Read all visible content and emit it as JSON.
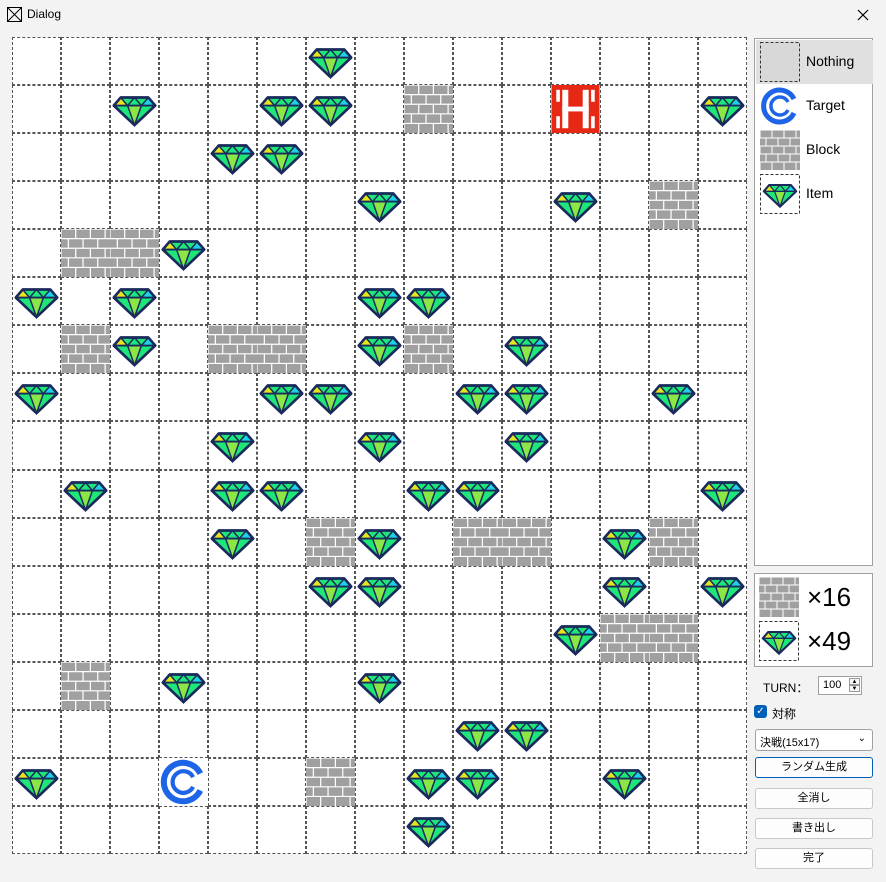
{
  "window": {
    "title": "Dialog"
  },
  "palette": {
    "items": [
      {
        "label": "Nothing",
        "type": "nothing",
        "selected": true
      },
      {
        "label": "Target",
        "type": "target",
        "selected": false
      },
      {
        "label": "Block",
        "type": "block",
        "selected": false
      },
      {
        "label": "Item",
        "type": "item",
        "selected": false
      }
    ]
  },
  "counts": {
    "block": "×16",
    "item": "×49"
  },
  "controls": {
    "turn_label": "TURN：",
    "turn_value": "100",
    "symmetric_label": "対称",
    "symmetric_checked": true,
    "size_select": "決戦(15x17)",
    "buttons": [
      "ランダム生成",
      "全消し",
      "書き出し",
      "完了"
    ]
  },
  "board": {
    "cols": 15,
    "rows": 17,
    "cells": [
      ". . . . . . I . . . . . . . .",
      ". . I . . I I . B . . H . . I",
      ". . . . I I . . . . . . . . .",
      ". . . . . . . I . . . I . B .",
      ". B B I . . . . . . . . . . .",
      "I . I . . . . I I . . . . . .",
      ". B I . B B . I B . I . . . .",
      "I . . . . I I . . I I . . I .",
      ". . . . I . . I . . I . . . .",
      ". I . . I I . . I I . . . . I",
      ". . . . I . B I . B B . I B .",
      ". . . . . . I I . . . . I . I",
      ". . . . . . . . . . . I B B .",
      ". B . I . . . I . . . . . . .",
      ". . . . . . . . . I I . . . .",
      "I . . T . . B . I I . . I . .",
      ". . . . . . . . I . . . . . ."
    ]
  },
  "colors": {
    "block_fill": "#a0a0a0",
    "block_line": "#ffffff",
    "gem_outline": "#1a2a5c",
    "gem_green": "#1ee678",
    "gem_yellow": "#e6e61e",
    "gem_cyan": "#1ed2e6",
    "target_blue": "#1e64e6",
    "home_red": "#e62814"
  }
}
